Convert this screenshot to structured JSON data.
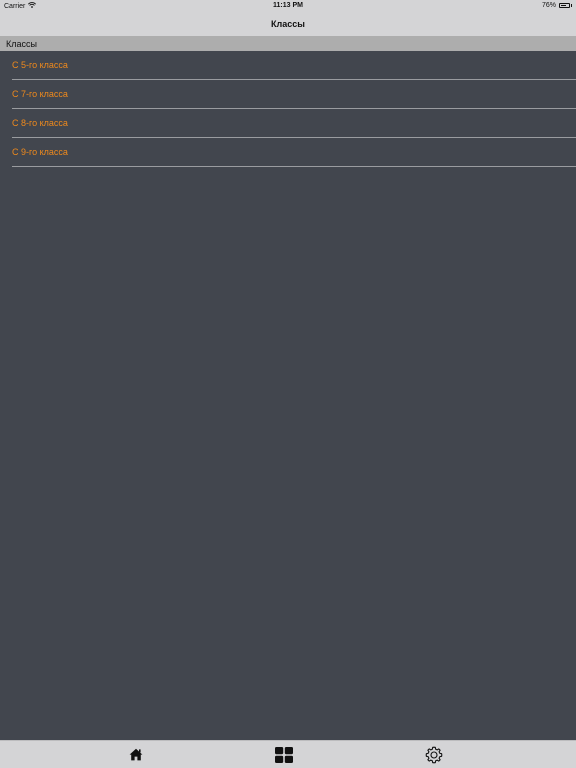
{
  "status_bar": {
    "carrier": "Carrier",
    "time": "11:13 PM",
    "battery_percent": "76%",
    "battery_level": 0.76
  },
  "nav": {
    "title": "Классы"
  },
  "section": {
    "header": "Классы"
  },
  "list": {
    "items": [
      {
        "label": "С 5-го класса"
      },
      {
        "label": "С 7-го класса"
      },
      {
        "label": "С 8-го класса"
      },
      {
        "label": "С 9-го класса"
      }
    ]
  },
  "colors": {
    "background": "#42464e",
    "accent": "#f08a1c",
    "bars": "#d4d4d6",
    "section_header": "#adadad"
  },
  "tabs": [
    {
      "icon": "home-icon"
    },
    {
      "icon": "grid-icon",
      "selected": true
    },
    {
      "icon": "gear-icon"
    }
  ]
}
